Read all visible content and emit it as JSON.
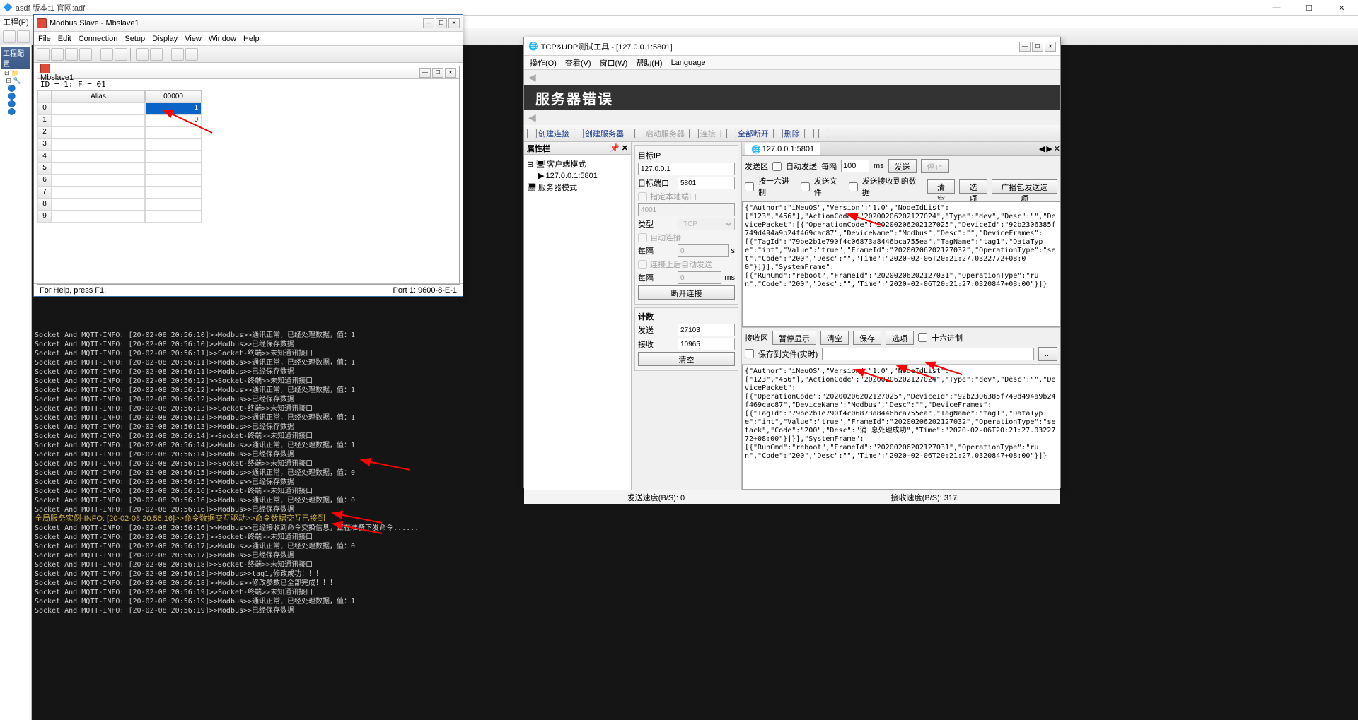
{
  "bg": {
    "title": "asdf 版本:1 官网:adf",
    "menu": [
      "工程(P)"
    ],
    "tree_head": "工程配置",
    "winctrl": [
      "—",
      "☐",
      "✕"
    ]
  },
  "mbs": {
    "title": "Modbus Slave - Mbslave1",
    "menu": [
      "File",
      "Edit",
      "Connection",
      "Setup",
      "Display",
      "View",
      "Window",
      "Help"
    ],
    "inner_title": "Mbslave1",
    "id_line": "ID = 1: F = 01",
    "headers": [
      "",
      "Alias",
      "00000"
    ],
    "rows": [
      {
        "i": "0",
        "a": "",
        "v": "1",
        "sel": true
      },
      {
        "i": "1",
        "a": "",
        "v": "0"
      },
      {
        "i": "2",
        "a": "",
        "v": ""
      },
      {
        "i": "3",
        "a": "",
        "v": ""
      },
      {
        "i": "4",
        "a": "",
        "v": ""
      },
      {
        "i": "5",
        "a": "",
        "v": ""
      },
      {
        "i": "6",
        "a": "",
        "v": ""
      },
      {
        "i": "7",
        "a": "",
        "v": ""
      },
      {
        "i": "8",
        "a": "",
        "v": ""
      },
      {
        "i": "9",
        "a": "",
        "v": ""
      }
    ],
    "status_left": "For Help, press F1.",
    "status_right": "Port 1: 9600-8-E-1"
  },
  "log": [
    "Socket And MQTT-INFO: [20-02-08 20:56:10]>>Modbus>>通讯正常，已经处理数据，值：1",
    "Socket And MQTT-INFO: [20-02-08 20:56:10]>>Modbus>>已经保存数据",
    "Socket And MQTT-INFO: [20-02-08 20:56:11]>>Socket-终端>>未知通讯接口",
    "Socket And MQTT-INFO: [20-02-08 20:56:11]>>Modbus>>通讯正常，已经处理数据，值：1",
    "Socket And MQTT-INFO: [20-02-08 20:56:11]>>Modbus>>已经保存数据",
    "Socket And MQTT-INFO: [20-02-08 20:56:12]>>Socket-终端>>未知通讯接口",
    "Socket And MQTT-INFO: [20-02-08 20:56:12]>>Modbus>>通讯正常，已经处理数据，值：1",
    "Socket And MQTT-INFO: [20-02-08 20:56:12]>>Modbus>>已经保存数据",
    "Socket And MQTT-INFO: [20-02-08 20:56:13]>>Socket-终端>>未知通讯接口",
    "Socket And MQTT-INFO: [20-02-08 20:56:13]>>Modbus>>通讯正常，已经处理数据，值：1",
    "Socket And MQTT-INFO: [20-02-08 20:56:13]>>Modbus>>已经保存数据",
    "Socket And MQTT-INFO: [20-02-08 20:56:14]>>Socket-终端>>未知通讯接口",
    "Socket And MQTT-INFO: [20-02-08 20:56:14]>>Modbus>>通讯正常，已经处理数据，值：1",
    "Socket And MQTT-INFO: [20-02-08 20:56:14]>>Modbus>>已经保存数据",
    "Socket And MQTT-INFO: [20-02-08 20:56:15]>>Socket-终端>>未知通讯接口",
    "Socket And MQTT-INFO: [20-02-08 20:56:15]>>Modbus>>通讯正常，已经处理数据，值：0",
    "Socket And MQTT-INFO: [20-02-08 20:56:15]>>Modbus>>已经保存数据",
    "Socket And MQTT-INFO: [20-02-08 20:56:16]>>Socket-终端>>未知通讯接口",
    "Socket And MQTT-INFO: [20-02-08 20:56:16]>>Modbus>>通讯正常，已经处理数据，值：0",
    "Socket And MQTT-INFO: [20-02-08 20:56:16]>>Modbus>>已经保存数据",
    "全局服务实例-INFO: [20-02-08 20:56:16]>>命令数据交互驱动>>命令数据交互已接到",
    "Socket And MQTT-INFO: [20-02-08 20:56:16]>>Modbus>>已经接收到命令交换信息，正在准备下发命令......",
    "Socket And MQTT-INFO: [20-02-08 20:56:17]>>Socket-终端>>未知通讯接口",
    "Socket And MQTT-INFO: [20-02-08 20:56:17]>>Modbus>>通讯正常，已经处理数据，值：0",
    "Socket And MQTT-INFO: [20-02-08 20:56:17]>>Modbus>>已经保存数据",
    "Socket And MQTT-INFO: [20-02-08 20:56:18]>>Socket-终端>>未知通讯接口",
    "Socket And MQTT-INFO: [20-02-08 20:56:18]>>Modbus>>tag1,修改成功！！！",
    "Socket And MQTT-INFO: [20-02-08 20:56:18]>>Modbus>>修改参数已全部完成！！！",
    "Socket And MQTT-INFO: [20-02-08 20:56:19]>>Socket-终端>>未知通讯接口",
    "Socket And MQTT-INFO: [20-02-08 20:56:19]>>Modbus>>通讯正常，已经处理数据，值：1",
    "Socket And MQTT-INFO: [20-02-08 20:56:19]>>Modbus>>已经保存数据"
  ],
  "tcp": {
    "title": "TCP&UDP测试工具 - [127.0.0.1:5801]",
    "menu": [
      "操作(O)",
      "查看(V)",
      "窗口(W)",
      "帮助(H)",
      "Language"
    ],
    "error": "服务器错误",
    "tool": {
      "create_conn": "创建连接",
      "create_srv": "创建服务器",
      "start_srv": "启动服务器",
      "connect": "连接",
      "disconn_all": "全部断开",
      "delete": "删除",
      "hex": ""
    },
    "attr_panel": "属性栏",
    "tree": {
      "client_mode": "客户端模式",
      "endpoint": "127.0.0.1:5801",
      "server_mode": "服务器模式"
    },
    "tab": "127.0.0.1:5801",
    "form": {
      "target_ip_lbl": "目标IP",
      "target_ip": "127.0.0.1",
      "target_port_lbl": "目标端口",
      "target_port": "5801",
      "local_port_chk": "指定本地端口",
      "local_port": "4001",
      "type_lbl": "类型",
      "type": "TCP",
      "auto_conn": "自动连接",
      "interval_lbl": "每隔",
      "interval": "0",
      "interval_unit": "s",
      "auto_send_after": "连接上后自动发送",
      "interval2_lbl": "每隔",
      "interval2": "0",
      "interval2_unit": "ms",
      "disconnect_btn": "断开连接",
      "count_lbl": "计数",
      "send_lbl": "发送",
      "send_count": "27103",
      "recv_lbl": "接收",
      "recv_count": "10965",
      "clear_btn": "清空"
    },
    "send": {
      "zone": "发送区",
      "auto": "自动发送",
      "every": "每隔",
      "ms_val": "100",
      "ms": "ms",
      "send_btn": "发送",
      "stop_btn": "停止",
      "hex": "按十六进制",
      "file": "发送文件",
      "recv_loop": "发送接收到的数据",
      "clear": "清空",
      "opt": "选项",
      "broadcast": "广播包发送选项"
    },
    "recv": {
      "zone": "接收区",
      "pause": "暂停显示",
      "clear": "清空",
      "save": "保存",
      "opt": "选项",
      "hex": "十六进制",
      "save_file": "保存到文件(实时)"
    },
    "send_text": "{\"Author\":\"iNeuOS\",\"Version\":\"1.0\",\"NodeIdList\":\n[\"123\",\"456\"],\"ActionCode\":\"20200206202127024\",\"Type\":\"dev\",\"Desc\":\"\",\"DevicePacket\":[{\"OperationCode\":\"20200206202127025\",\"DeviceId\":\"92b2306385f749d494a9b24f469cac87\",\"DeviceName\":\"Modbus\",\"Desc\":\"\",\"DeviceFrames\":\n[{\"TagId\":\"79be2b1e790f4c06873a8446bca755ea\",\"TagName\":\"tag1\",\"DataType\":\"int\",\"Value\":\"true\",\"FrameId\":\"20200206202127032\",\"OperationType\":\"set\",\"Code\":\"200\",\"Desc\":\"\",\"Time\":\"2020-02-06T20:21:27.0322772+08:00\"}]}],\"SystemFrame\":\n[{\"RunCmd\":\"reboot\",\"FrameId\":\"20200206202127031\",\"OperationType\":\"run\",\"Code\":\"200\",\"Desc\":\"\",\"Time\":\"2020-02-06T20:21:27.0320847+08:00\"}]}",
    "recv_text": "{\"Author\":\"iNeuOS\",\"Version\":\"1.0\",\"NodeIdList\":\n[\"123\",\"456\"],\"ActionCode\":\"20200206202127024\",\"Type\":\"dev\",\"Desc\":\"\",\"DevicePacket\":\n[{\"OperationCode\":\"20200206202127025\",\"DeviceId\":\"92b2306385f749d494a9b24f469cac87\",\"DeviceName\":\"Modbus\",\"Desc\":\"\",\"DeviceFrames\":\n[{\"TagId\":\"79be2b1e790f4c06873a8446bca755ea\",\"TagName\":\"tag1\",\"DataType\":\"int\",\"Value\":\"true\",\"FrameId\":\"20200206202127032\",\"OperationType\":\"setack\",\"Code\":\"200\",\"Desc\":\"消 息处理成功\",\"Time\":\"2020-02-06T20:21:27.0322772+08:00\"}]}],\"SystemFrame\":\n[{\"RunCmd\":\"reboot\",\"FrameId\":\"20200206202127031\",\"OperationType\":\"run\",\"Code\":\"200\",\"Desc\":\"\",\"Time\":\"2020-02-06T20:21:27.0320847+08:00\"}]}",
    "status": {
      "send": "发送速度(B/S): 0",
      "recv": "接收速度(B/S): 317"
    }
  }
}
